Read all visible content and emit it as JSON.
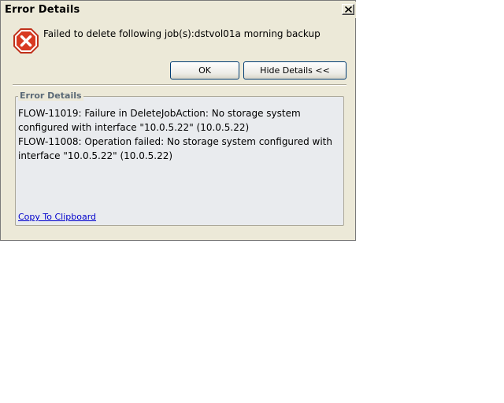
{
  "window": {
    "title": "Error Details",
    "close_icon": "close-icon"
  },
  "message": {
    "icon": "error-icon",
    "text": "Failed to delete following job(s):dstvol01a morning backup"
  },
  "buttons": {
    "ok_label": "OK",
    "details_label": "Hide Details <<"
  },
  "details": {
    "legend": "Error Details",
    "lines": [
      "FLOW-11019: Failure in DeleteJobAction: No storage system",
      "configured with interface \"10.0.5.22\" (10.0.5.22)",
      "FLOW-11008: Operation failed: No storage system configured with",
      "interface \"10.0.5.22\" (10.0.5.22)"
    ],
    "copy_link": "Copy To Clipboard"
  },
  "colors": {
    "dialog_background": "#ece9d8",
    "error_red": "#d83a22",
    "link": "#0000cc",
    "legend_text": "#5b6a77"
  }
}
